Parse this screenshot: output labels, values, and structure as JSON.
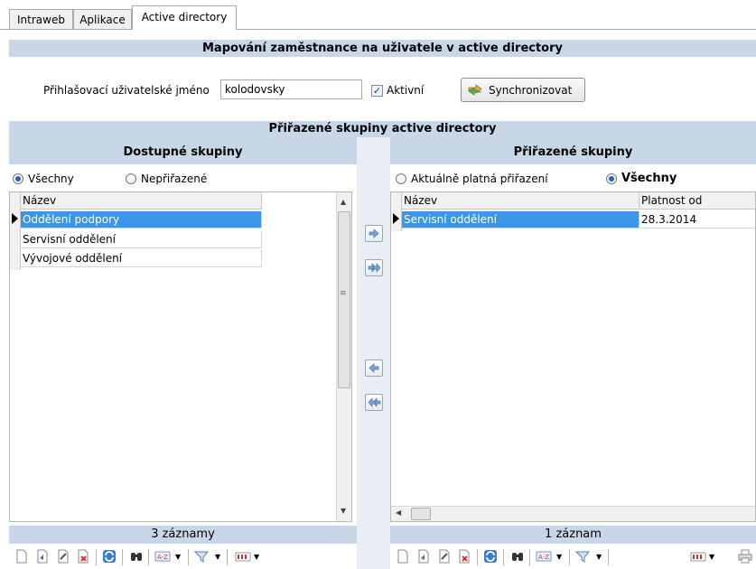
{
  "tabs": [
    {
      "label": "Intraweb"
    },
    {
      "label": "Aplikace"
    },
    {
      "label": "Active directory"
    }
  ],
  "mapping": {
    "title": "Mapování zaměstnance na uživatele v active directory",
    "login_label": "Přihlašovací uživatelské jméno",
    "login_value": "kolodovsky",
    "active_label": "Aktivní",
    "active_checked": true,
    "sync_label": "Synchronizovat"
  },
  "groups": {
    "title": "Přiřazené skupiny active directory"
  },
  "available": {
    "title": "Dostupné skupiny",
    "radio_all": "Všechny",
    "radio_unassigned": "Nepřiřazené",
    "col_name": "Název",
    "rows": [
      "Oddělení podpory",
      "Servisní oddělení",
      "Vývojové oddělení"
    ],
    "footer": "3 záznamy"
  },
  "assigned": {
    "title": "Přiřazené skupiny",
    "radio_current": "Aktuálně platná přiřazení",
    "radio_all": "Všechny",
    "col_name": "Název",
    "col_valid_from": "Platnost od",
    "rows": [
      {
        "name": "Servisní oddělení",
        "valid_from": "28.3.2014"
      }
    ],
    "footer": "1 záznam"
  },
  "colors": {
    "band": "#c8d7e8",
    "selection": "#3b95e8"
  }
}
